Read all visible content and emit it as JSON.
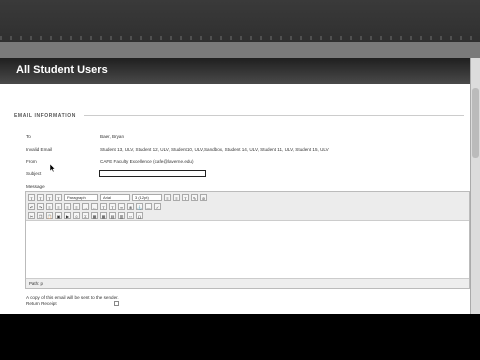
{
  "page": {
    "title": "All Student Users",
    "section": "EMAIL INFORMATION"
  },
  "form": {
    "to_label": "To",
    "to_value": "Baer, Bryan",
    "invalid_label": "Invalid Email",
    "invalid_value": "Student 13, ULV, Student 12, ULV, Student10, ULV,Sandbox, Student 14, ULV, Student 11, ULV, Student 15, ULV",
    "from_label": "From",
    "from_value": "CAFE Faculty Excellence (cafe@laverne.edu)",
    "subject_label": "Subject",
    "subject_value": "",
    "message_label": "Message"
  },
  "editor": {
    "format_select": "Paragraph",
    "font_select": "Arial",
    "size_select": "3 (12pt)",
    "path_text": "Path: p"
  },
  "footer": {
    "copy_note": "A copy of this email will be sent to the sender.",
    "receipt_label": "Return Receipt"
  },
  "icons": [
    "text-format-icon",
    "bold-icon",
    "italic-icon",
    "underline-icon",
    "strikethrough-icon",
    "list-icon",
    "align-icon",
    "link-icon",
    "image-icon",
    "table-icon",
    "html-icon",
    "scrollbar"
  ]
}
